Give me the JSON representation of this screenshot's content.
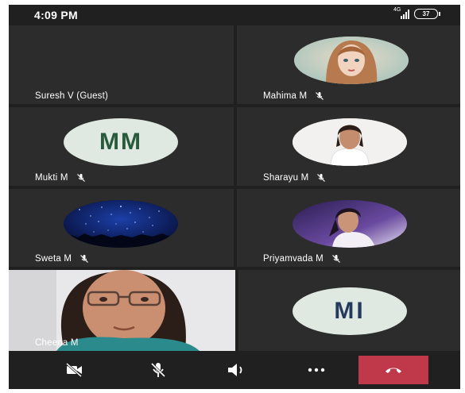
{
  "status_bar": {
    "time": "4:09 PM",
    "network": "4G",
    "battery": "37"
  },
  "participants": [
    {
      "name": "Suresh V (Guest)",
      "avatar": "none",
      "muted": false
    },
    {
      "name": "Mahima M",
      "avatar": "photo",
      "muted": true
    },
    {
      "name": "Mukti M",
      "avatar": "initials",
      "initials": "MM",
      "muted": true
    },
    {
      "name": "Sharayu M",
      "avatar": "photo",
      "muted": true
    },
    {
      "name": "Sweta M",
      "avatar": "photo",
      "muted": true
    },
    {
      "name": "Priyamvada M",
      "avatar": "photo",
      "muted": true
    },
    {
      "name": "Cheena M",
      "avatar": "video",
      "muted": false
    },
    {
      "name": "",
      "avatar": "initials",
      "initials": "MI",
      "muted": false
    }
  ],
  "controls": {
    "camera_icon": "camera-off-icon",
    "mic_icon": "mic-off-icon",
    "speaker_icon": "speaker-icon",
    "more_icon": "more-options-icon",
    "end_call_icon": "end-call-icon",
    "end_call_color": "#c0394b"
  },
  "colors": {
    "background": "#202020",
    "tile": "#2c2c2c",
    "initials_bg": "#dfe9e2",
    "initials_mm": "#2a5a3c",
    "initials_mi": "#243a5c"
  }
}
